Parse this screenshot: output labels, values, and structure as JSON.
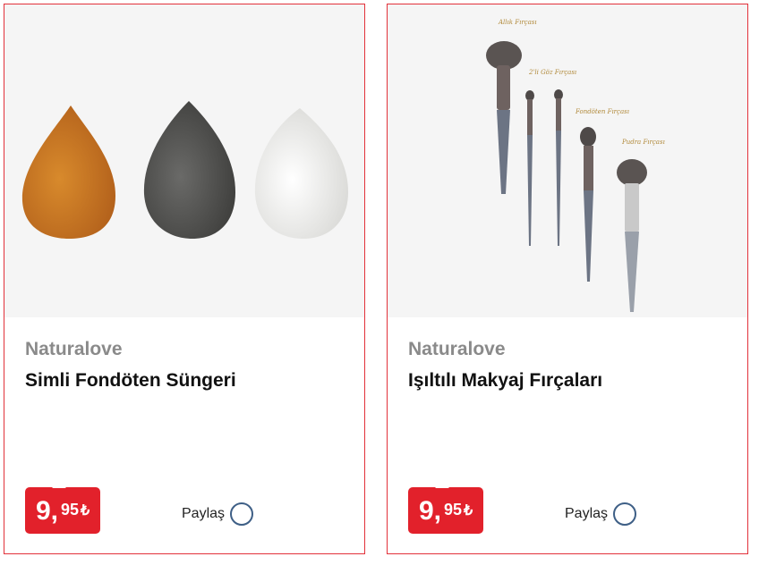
{
  "products": [
    {
      "brand": "Naturalove",
      "title": "Simli Fondöten Süngeri",
      "price_whole": "9,",
      "price_fraction": "95",
      "currency": "₺",
      "share_label": "Paylaş",
      "image_icon": "makeup-sponges-image"
    },
    {
      "brand": "Naturalove",
      "title": "Işıltılı Makyaj Fırçaları",
      "price_whole": "9,",
      "price_fraction": "95",
      "currency": "₺",
      "share_label": "Paylaş",
      "image_icon": "makeup-brushes-image",
      "image_labels": [
        "Allık Fırçası",
        "2'li Göz Fırçası",
        "Fondöten Fırçası",
        "Pudra Fırçası"
      ]
    }
  ],
  "colors": {
    "accent": "#e2212b",
    "border": "#e2313a",
    "brand_text": "#8a8a8a",
    "share_circle": "#3e5f86"
  }
}
